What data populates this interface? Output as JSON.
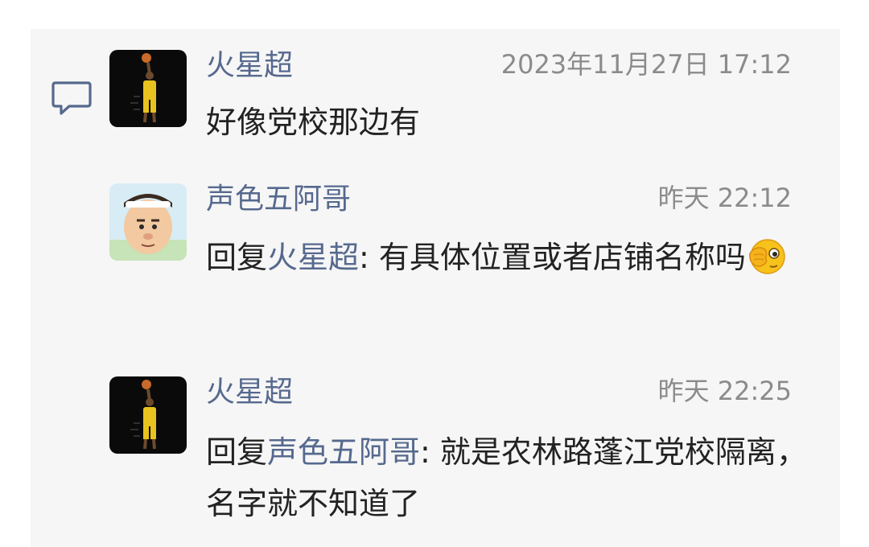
{
  "comments": [
    {
      "author": "火星超",
      "time": "2023年11月27日 17:12",
      "text": "好像党校那边有",
      "avatar_icon": "basketball-player-avatar"
    },
    {
      "author": "声色五阿哥",
      "time": "昨天 22:12",
      "reply_prefix": "回复",
      "reply_to": "火星超",
      "separator": ":",
      "text": " 有具体位置或者店铺名称吗",
      "emoji_icon": "face-with-hand-over-eye-emoji",
      "avatar_icon": "cartoon-face-avatar"
    },
    {
      "author": "火星超",
      "time": "昨天 22:25",
      "reply_prefix": "回复",
      "reply_to": "声色五阿哥",
      "separator": ":",
      "text": " 就是农林路蓬江党校隔离，名字就不知道了",
      "avatar_icon": "basketball-player-avatar"
    }
  ],
  "colors": {
    "author_name": "#56698e",
    "timestamp": "#8b8b8b",
    "body_text": "#222222",
    "panel_background": "#f6f6f6"
  },
  "icons": [
    "comment-icon",
    "basketball-player-avatar",
    "cartoon-face-avatar",
    "face-with-hand-over-eye-emoji"
  ]
}
